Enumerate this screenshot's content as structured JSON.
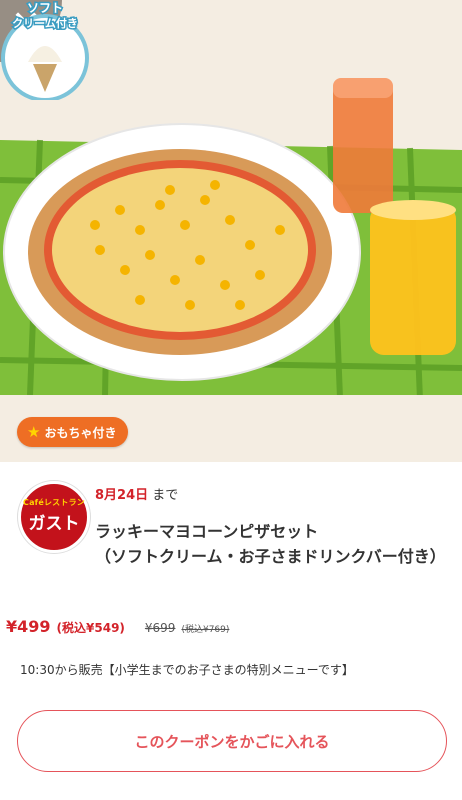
{
  "header": {
    "close_icon": "close-icon"
  },
  "hero": {
    "alt": "Lucky corn pizza set with soft cream and drinks",
    "soft_cream_badge_line1": "ソフト",
    "soft_cream_badge_line2": "クリーム付き",
    "toy_badge_label": "おもちゃ付き",
    "toy_badge_icon": "star-icon"
  },
  "colors": {
    "accent_red": "#d3232a",
    "toy_orange": "#ee6e24",
    "cta_border": "#e5545a"
  },
  "store": {
    "logo_top": "Caféレストラン",
    "logo_main": "ガスト"
  },
  "coupon": {
    "valid_date": "8月24日",
    "valid_suffix": "まで",
    "title": "ラッキーマヨコーンピザセット\n（ソフトクリーム・お子さまドリンクバー付き）",
    "price": "¥499",
    "price_tax": "(税込¥549)",
    "original_price": "¥699",
    "original_price_tax": "(税込¥769)",
    "note": "10:30から販売【小学生までのお子さまの特別メニューです】",
    "cta_label": "このクーポンをかごに入れる"
  }
}
